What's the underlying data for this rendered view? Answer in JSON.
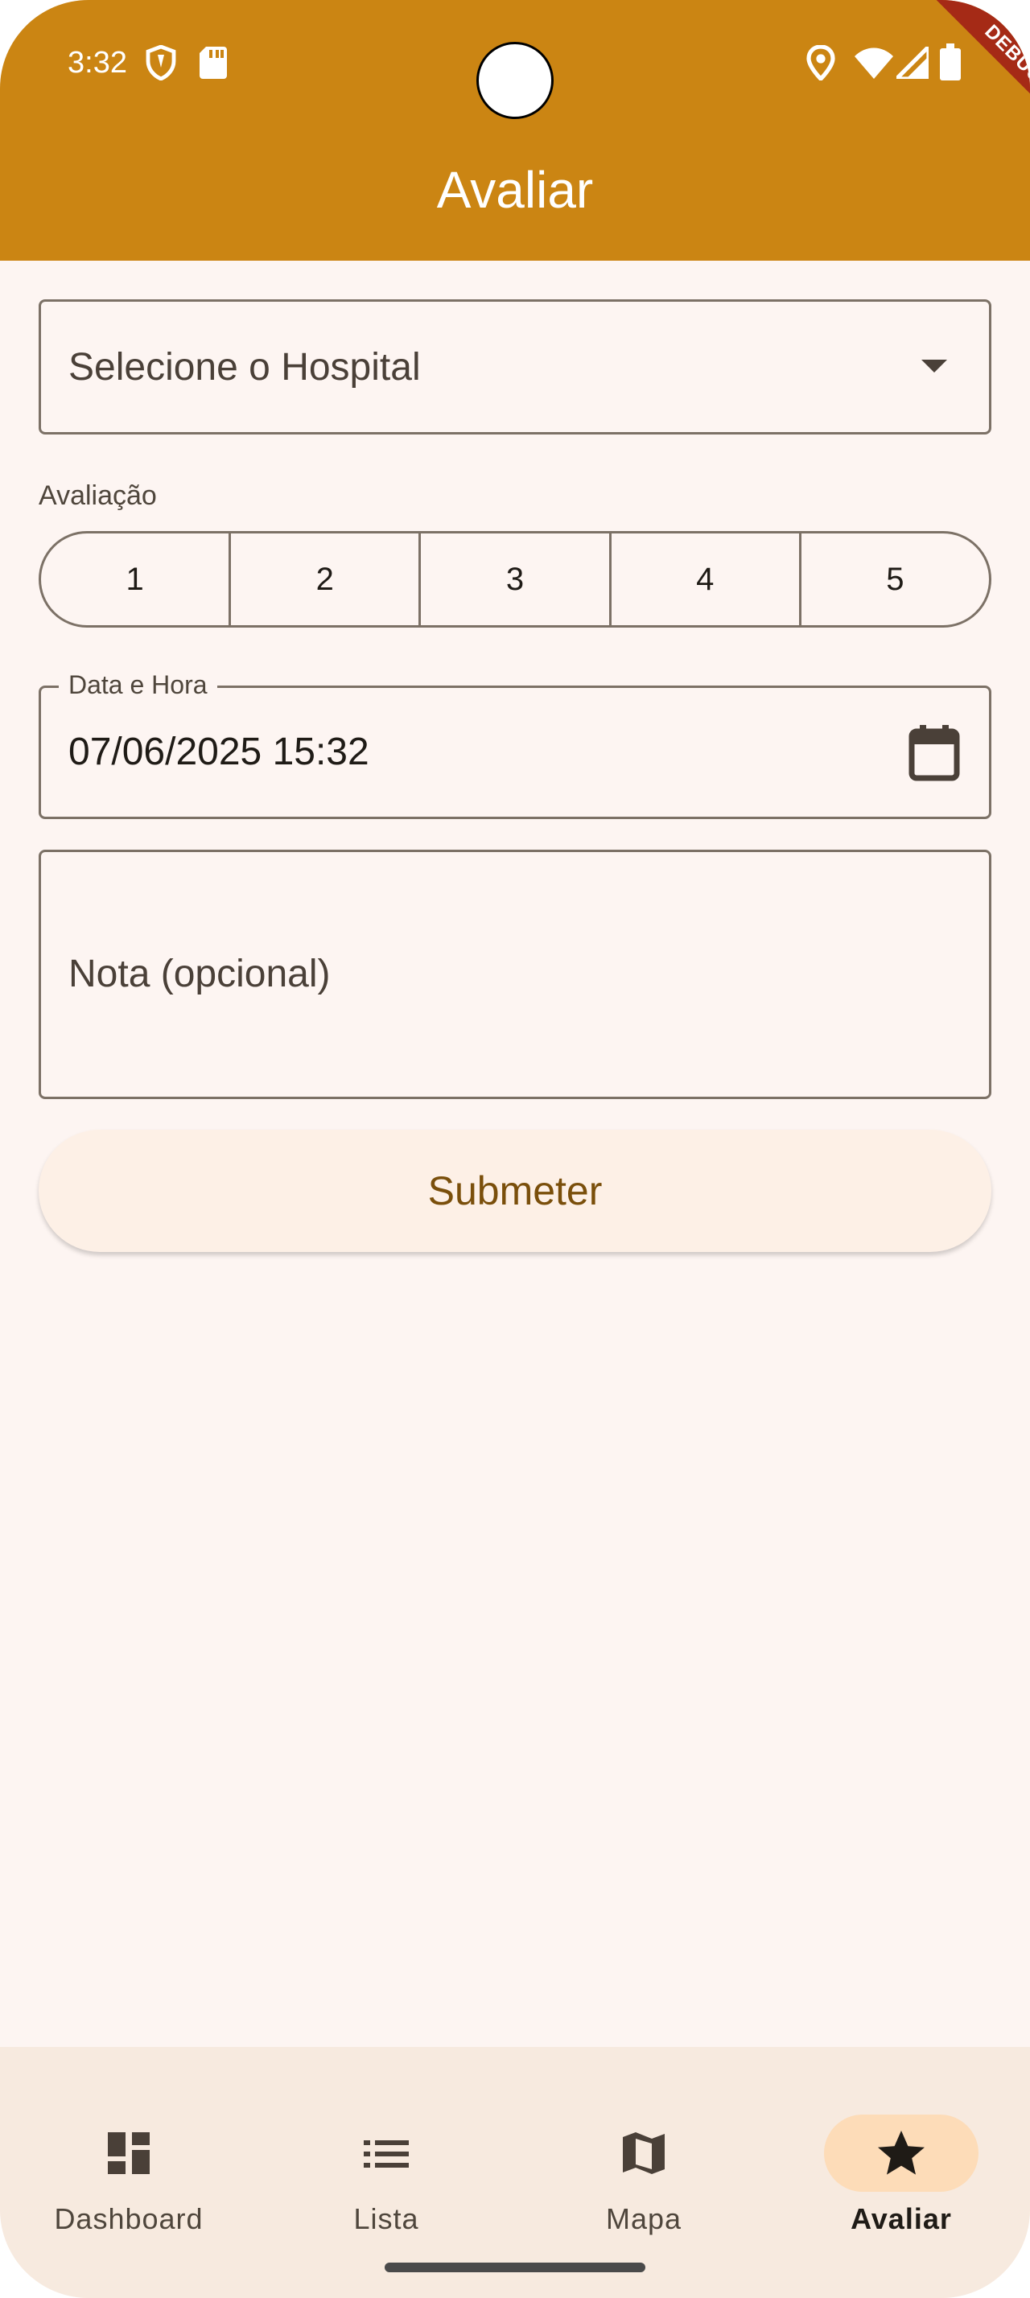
{
  "status_bar": {
    "time": "3:32"
  },
  "debug_banner": "DEBUG",
  "app_bar": {
    "title": "Avaliar"
  },
  "hospital_dropdown": {
    "placeholder": "Selecione o Hospital"
  },
  "rating": {
    "label": "Avaliação",
    "options": [
      "1",
      "2",
      "3",
      "4",
      "5"
    ]
  },
  "datetime_field": {
    "label": "Data e Hora",
    "value": "07/06/2025 15:32"
  },
  "note_field": {
    "placeholder": "Nota (opcional)"
  },
  "submit_button": {
    "label": "Submeter"
  },
  "bottom_nav": {
    "items": [
      {
        "label": "Dashboard",
        "icon": "dashboard-icon",
        "active": false
      },
      {
        "label": "Lista",
        "icon": "list-icon",
        "active": false
      },
      {
        "label": "Mapa",
        "icon": "map-icon",
        "active": false
      },
      {
        "label": "Avaliar",
        "icon": "star-icon",
        "active": true
      }
    ]
  },
  "colors": {
    "app_bar": "#cb8513",
    "background": "#fdf5f2",
    "nav_background": "#f7eadf",
    "active_pill": "#fddcb8",
    "submit_text": "#7a4f0b"
  }
}
